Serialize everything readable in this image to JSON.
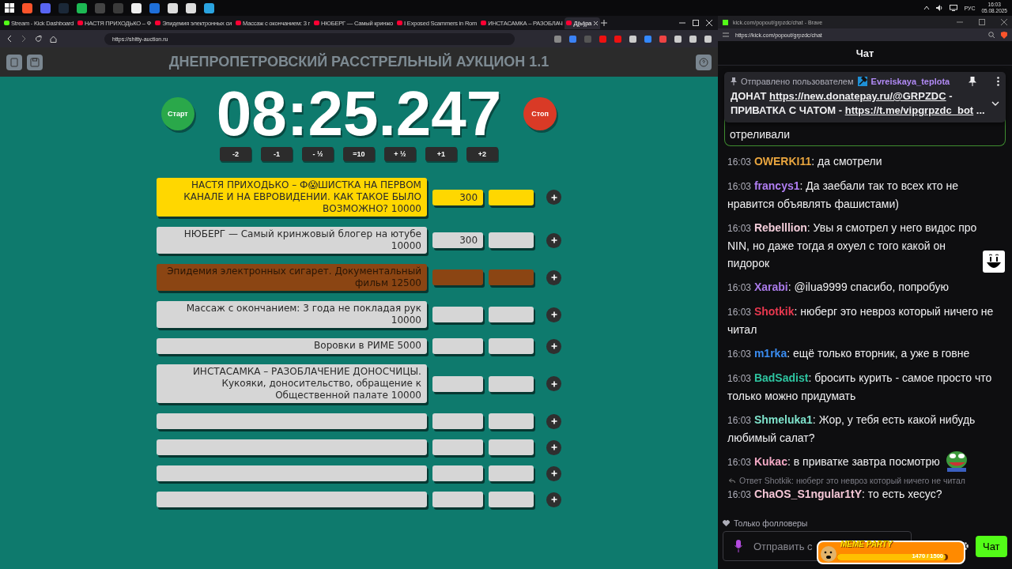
{
  "taskbar": {
    "tray": {
      "language": "РУС",
      "time": "16:03",
      "date": "05.08.2025"
    }
  },
  "browser": {
    "tabs": [
      {
        "label": "Stream - Kick Dashboard",
        "selected": false
      },
      {
        "label": "НАСТЯ ПРИХОДЬКО – Ф",
        "selected": false
      },
      {
        "label": "Эпидемия электронных си",
        "selected": false
      },
      {
        "label": "Массаж с окончанием: 3 г",
        "selected": false
      },
      {
        "label": "НЮБЕРГ — Самый кринжо",
        "selected": false
      },
      {
        "label": "I Exposed Scammers in Rom",
        "selected": false
      },
      {
        "label": "ИНСТАСАМКА – РАЗОБЛАЧ",
        "selected": false
      },
      {
        "label": "Д(ы)ра",
        "selected": true
      }
    ],
    "url": "https://shitty-auction.ru"
  },
  "auction": {
    "title": "ДНЕПРОПЕТРОВСКИЙ РАССТРЕЛЬНЫЙ АУКЦИОН 1.1",
    "timer": "08:25.247",
    "start": "Старт",
    "stop": "Стоп",
    "adjust_buttons": [
      "-2",
      "-1",
      "- ½",
      "=10",
      "+ ½",
      "+1",
      "+2"
    ],
    "lots": [
      {
        "title": "НАСТЯ ПРИХОДЬКО – Ф😱ШИСТКА НА ПЕРВОМ КАНАЛЕ И НА ЕВРОВИДЕНИИ. КАК ТАКОЕ БЫЛО ВОЗМОЖНО? 10000",
        "amount": "300",
        "color": "#ffd700"
      },
      {
        "title": "НЮБЕРГ — Самый кринжовый блогер на ютубе 10000",
        "amount": "300",
        "color": "#d6d6d6"
      },
      {
        "title": "Эпидемия электронных сигарет. Документальный фильм 12500",
        "color": "#8b4513"
      },
      {
        "title": "Массаж с окончанием: 3 года не покладая рук 10000",
        "color": "#d6d6d6"
      },
      {
        "title": "Воровки в РИМЕ 5000",
        "color": "#d6d6d6"
      },
      {
        "title": "ИНСТАСАМКА – РАЗОБЛАЧЕНИЕ ДОНОСЧИЦЫ. Кукояки, доносительство, обращение к Общественной палате 10000",
        "color": "#d6d6d6"
      },
      {
        "color": "#d6d6d6"
      },
      {
        "color": "#d6d6d6"
      },
      {
        "color": "#d6d6d6"
      },
      {
        "color": "#d6d6d6"
      }
    ]
  },
  "chat_window": {
    "title": "kick.com/popout/grpzdc/chat - Brave",
    "url": "https://kick.com/popout/grpzdc/chat",
    "heading": "Чат",
    "pinned": {
      "label": "Отправлено пользователем",
      "user": "Evreiskaya_teplota",
      "message": [
        {
          "kind": "text",
          "text": "ДОНАТ "
        },
        {
          "kind": "link",
          "text": "https://new.donatepay.ru/@GRPZDC"
        },
        {
          "kind": "text",
          "text": " - ПРИВАТКА С ЧАТОМ - "
        },
        {
          "kind": "link",
          "text": "https://t.me/vipgrpzdc_bot"
        },
        {
          "kind": "text",
          "text": " ..."
        }
      ]
    },
    "highlighted_tail": "отреливали",
    "messages": [
      {
        "time": "16:03",
        "user": "OWERKI11",
        "color": "#e9a53e",
        "text": ": да смотрели",
        "kind": "plain"
      },
      {
        "time": "16:03",
        "user": "francys1",
        "color": "#b07ef2",
        "text": ": Да заебали так то всех кто не нравится объявлять фашистами)",
        "kind": "plain"
      },
      {
        "time": "16:03",
        "user": "Rebelllion",
        "color": "#f2ccd9",
        "text": ": Увы я смотрел у него видос про NIN, но даже тогда я охуел с того какой он пидорок",
        "kind": "smiley"
      },
      {
        "time": "16:03",
        "user": "Xarabi",
        "color": "#a97ae8",
        "text": ": @ilua9999 спасибо, попробую",
        "kind": "plain"
      },
      {
        "time": "16:03",
        "user": "Shotkik",
        "color": "#e8384f",
        "text": ": нюберг это невроз который ничего не читал",
        "kind": "plain"
      },
      {
        "time": "16:03",
        "user": "m1rka",
        "color": "#3a8cf0",
        "text": ": ещё только вторник, а уже в говне",
        "kind": "plain"
      },
      {
        "time": "16:03",
        "user": "BadSadist",
        "color": "#2ec4a0",
        "text": ": бросить курить - самое просто что только можно придумать",
        "kind": "plain"
      },
      {
        "time": "16:03",
        "user": "Shmeluka1",
        "color": "#7fe3cc",
        "text": ": Жор, у тебя есть какой нибудь любимый салат?",
        "kind": "plain"
      },
      {
        "time": "16:03",
        "user": "Kukac",
        "color": "#f2a8c4",
        "text": ": в приватке завтра посмотрю",
        "kind": "frog"
      },
      {
        "time": "16:03",
        "user": "ChaOS_S1ngular1tY",
        "color": "#f5c6d6",
        "text": ": то есть хесус?",
        "kind": "plain",
        "reply": "Ответ Shotkik: нюберг это невроз который ничего не читал"
      }
    ],
    "followers_only": "Только фолловеры",
    "placeholder": "Отправить с",
    "send": "Чат",
    "meme_party": {
      "label": "MEME PARTY",
      "count": "1470 / 1500",
      "level": 0.98
    }
  }
}
